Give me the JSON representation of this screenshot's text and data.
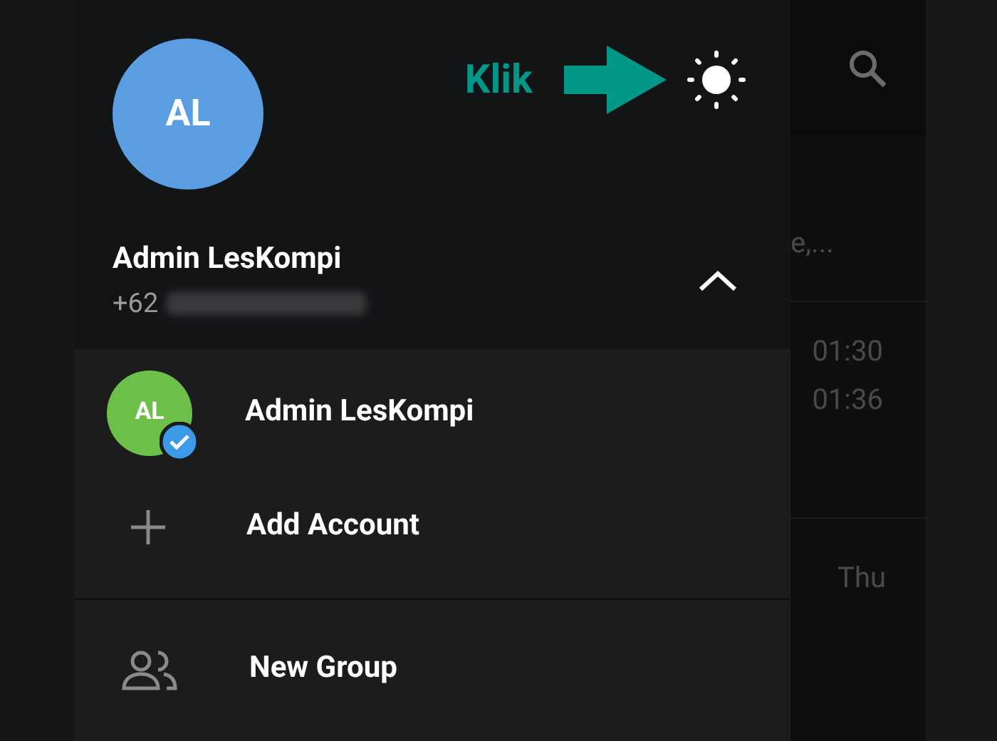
{
  "annotation": {
    "label": "Klik"
  },
  "profile": {
    "initials": "AL",
    "name": "Admin LesKompi",
    "phone_prefix": "+62",
    "accounts_expanded": true
  },
  "accounts": [
    {
      "kind": "account",
      "initials": "AL",
      "name": "Admin LesKompi",
      "selected": true
    },
    {
      "kind": "add",
      "label": "Add Account"
    }
  ],
  "menu": [
    {
      "label": "New Group"
    }
  ],
  "chat_list": [
    {
      "preview": "e,..."
    },
    {
      "time": "01:30"
    },
    {
      "time": "01:36"
    },
    {
      "time": "Thu"
    }
  ]
}
